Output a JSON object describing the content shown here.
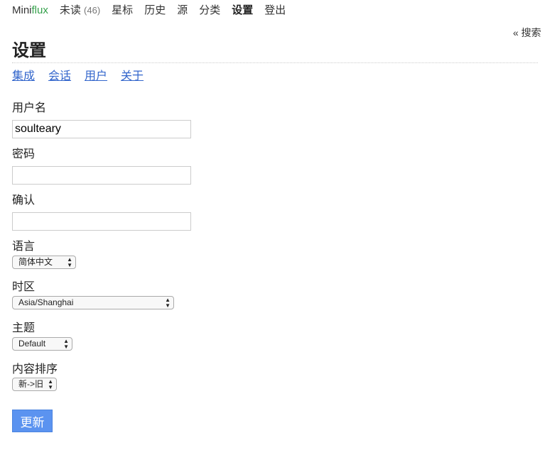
{
  "nav": {
    "logo_a": "Mini",
    "logo_b": "flux",
    "unread": "未读",
    "unread_count": "(46)",
    "starred": "星标",
    "history": "历史",
    "feeds": "源",
    "categories": "分类",
    "settings": "设置",
    "logout": "登出"
  },
  "search_link": "« 搜索",
  "page_title": "设置",
  "subnav": [
    "集成",
    "会话",
    "用户",
    "关于"
  ],
  "form": {
    "username_label": "用户名",
    "username_value": "soulteary",
    "password_label": "密码",
    "password_value": "",
    "confirm_label": "确认",
    "confirm_value": "",
    "language_label": "语言",
    "language_value": "简体中文",
    "timezone_label": "时区",
    "timezone_value": "Asia/Shanghai",
    "theme_label": "主题",
    "theme_value": "Default",
    "sort_label": "内容排序",
    "sort_value": "新->旧",
    "submit": "更新"
  }
}
